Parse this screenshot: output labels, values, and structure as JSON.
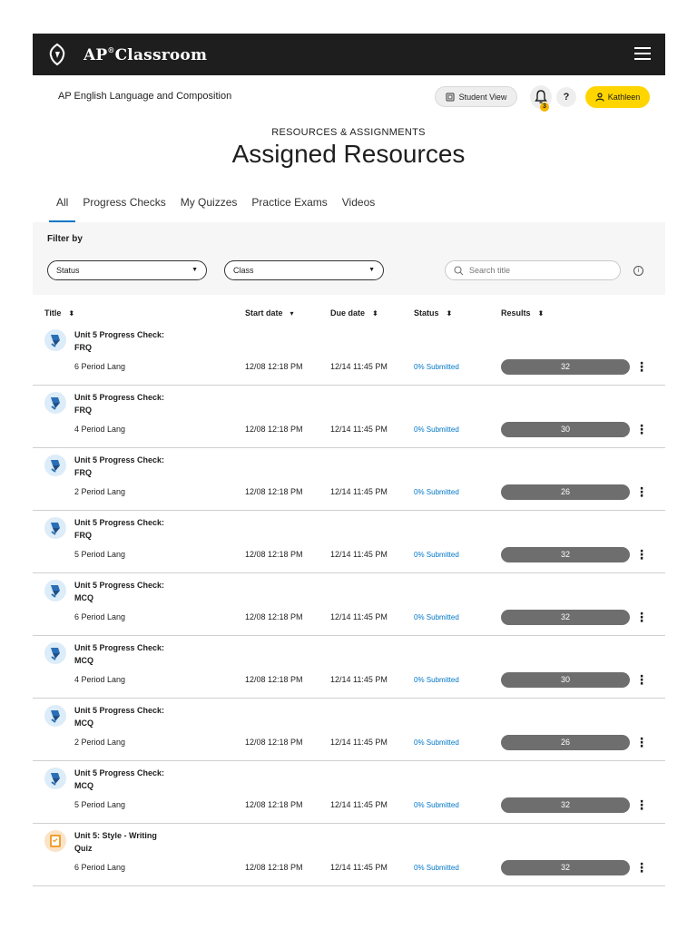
{
  "header": {
    "brand_prefix": "AP",
    "brand_mark": "®",
    "brand_suffix": "Classroom",
    "course": "AP English Language and Composition",
    "student_view": "Student View",
    "notification_count": "3",
    "help_label": "?",
    "user_name": "Kathleen"
  },
  "page": {
    "eyebrow": "RESOURCES & ASSIGNMENTS",
    "title": "Assigned Resources"
  },
  "tabs": [
    {
      "label": "All",
      "active": true
    },
    {
      "label": "Progress Checks"
    },
    {
      "label": "My Quizzes"
    },
    {
      "label": "Practice Exams"
    },
    {
      "label": "Videos"
    }
  ],
  "filters": {
    "label": "Filter by",
    "status_select": "Status",
    "class_select": "Class",
    "search_placeholder": "Search title"
  },
  "columns": {
    "title": "Title",
    "start": "Start date",
    "due": "Due date",
    "status": "Status",
    "results": "Results"
  },
  "rows": [
    {
      "icon": "progress-check-icon",
      "title": "Unit 5 Progress Check: FRQ",
      "class": "6 Period Lang",
      "start": "12/08 12:18 PM",
      "due": "12/14 11:45 PM",
      "status": "0% Submitted",
      "result": "32"
    },
    {
      "icon": "progress-check-icon",
      "title": "Unit 5 Progress Check: FRQ",
      "class": "4 Period Lang",
      "start": "12/08 12:18 PM",
      "due": "12/14 11:45 PM",
      "status": "0% Submitted",
      "result": "30"
    },
    {
      "icon": "progress-check-icon",
      "title": "Unit 5 Progress Check: FRQ",
      "class": "2 Period Lang",
      "start": "12/08 12:18 PM",
      "due": "12/14 11:45 PM",
      "status": "0% Submitted",
      "result": "26"
    },
    {
      "icon": "progress-check-icon",
      "title": "Unit 5 Progress Check: FRQ",
      "class": "5 Period Lang",
      "start": "12/08 12:18 PM",
      "due": "12/14 11:45 PM",
      "status": "0% Submitted",
      "result": "32"
    },
    {
      "icon": "progress-check-icon",
      "title": "Unit 5 Progress Check: MCQ",
      "class": "6 Period Lang",
      "start": "12/08 12:18 PM",
      "due": "12/14 11:45 PM",
      "status": "0% Submitted",
      "result": "32"
    },
    {
      "icon": "progress-check-icon",
      "title": "Unit 5 Progress Check: MCQ",
      "class": "4 Period Lang",
      "start": "12/08 12:18 PM",
      "due": "12/14 11:45 PM",
      "status": "0% Submitted",
      "result": "30"
    },
    {
      "icon": "progress-check-icon",
      "title": "Unit 5 Progress Check: MCQ",
      "class": "2 Period Lang",
      "start": "12/08 12:18 PM",
      "due": "12/14 11:45 PM",
      "status": "0% Submitted",
      "result": "26"
    },
    {
      "icon": "progress-check-icon",
      "title": "Unit 5 Progress Check: MCQ",
      "class": "5 Period Lang",
      "start": "12/08 12:18 PM",
      "due": "12/14 11:45 PM",
      "status": "0% Submitted",
      "result": "32"
    },
    {
      "icon": "quiz-icon",
      "title": "Unit 5: Style - Writing Quiz",
      "class": "6 Period Lang",
      "start": "12/08 12:18 PM",
      "due": "12/14 11:45 PM",
      "status": "0% Submitted",
      "result": "32"
    }
  ],
  "colors": {
    "topbar": "#1e1e1e",
    "accent_blue": "#0077c8",
    "user_yellow": "#ffd500",
    "result_bar": "#6e6e6e"
  }
}
